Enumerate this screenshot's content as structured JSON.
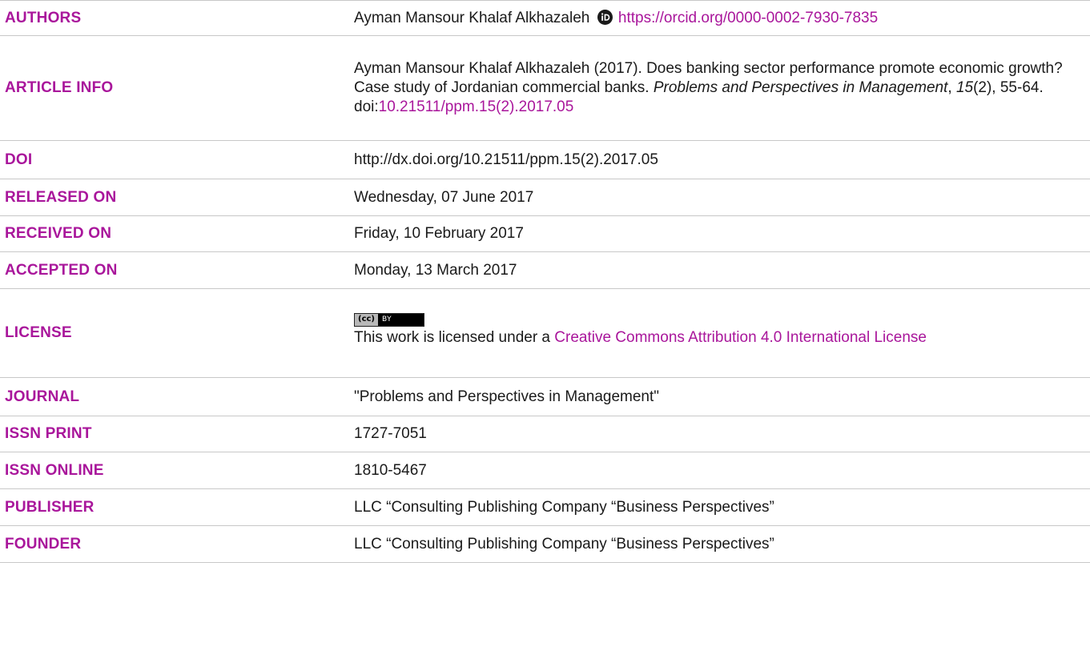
{
  "colors": {
    "label": "#a9169b",
    "link": "#a9169b",
    "text": "#1a1a1a",
    "divider": "#c8c8c8"
  },
  "authors": {
    "label": "AUTHORS",
    "name": "Ayman Mansour Khalaf Alkhazaleh",
    "icon": "orcid-icon",
    "orcid_url": "https://orcid.org/0000-0002-7930-7835"
  },
  "article_info": {
    "label": "ARTICLE INFO",
    "citation_part1": "Ayman Mansour Khalaf Alkhazaleh (2017). Does banking sector performance promote economic growth? Case study of Jordanian commercial banks.",
    "journal_name": "Problems and Perspectives in Management",
    "sep1": ", ",
    "volume": "15",
    "issue_pages": "(2), 55-64.",
    "doi_prefix": "doi:",
    "doi_link": "10.21511/ppm.15(2).2017.05"
  },
  "doi": {
    "label": "DOI",
    "value": "http://dx.doi.org/10.21511/ppm.15(2).2017.05"
  },
  "released_on": {
    "label": "RELEASED ON",
    "value": "Wednesday, 07 June 2017"
  },
  "received_on": {
    "label": "RECEIVED ON",
    "value": "Friday, 10 February 2017"
  },
  "accepted_on": {
    "label": "ACCEPTED ON",
    "value": "Monday, 13 March 2017"
  },
  "license": {
    "label": "LICENSE",
    "badge_left": "(cc)",
    "badge_right": "BY",
    "text_prefix": "This work is licensed under a ",
    "link_text": "Creative Commons Attribution 4.0 International License"
  },
  "journal": {
    "label": "JOURNAL",
    "value": "\"Problems and Perspectives in Management\""
  },
  "issn_print": {
    "label": "ISSN PRINT",
    "value": "1727-7051"
  },
  "issn_online": {
    "label": "ISSN ONLINE",
    "value": "1810-5467"
  },
  "publisher": {
    "label": "PUBLISHER",
    "value": "LLC “Consulting Publishing Company “Business Perspectives”"
  },
  "founder": {
    "label": "FOUNDER",
    "value": "LLC “Consulting Publishing Company “Business Perspectives”"
  }
}
